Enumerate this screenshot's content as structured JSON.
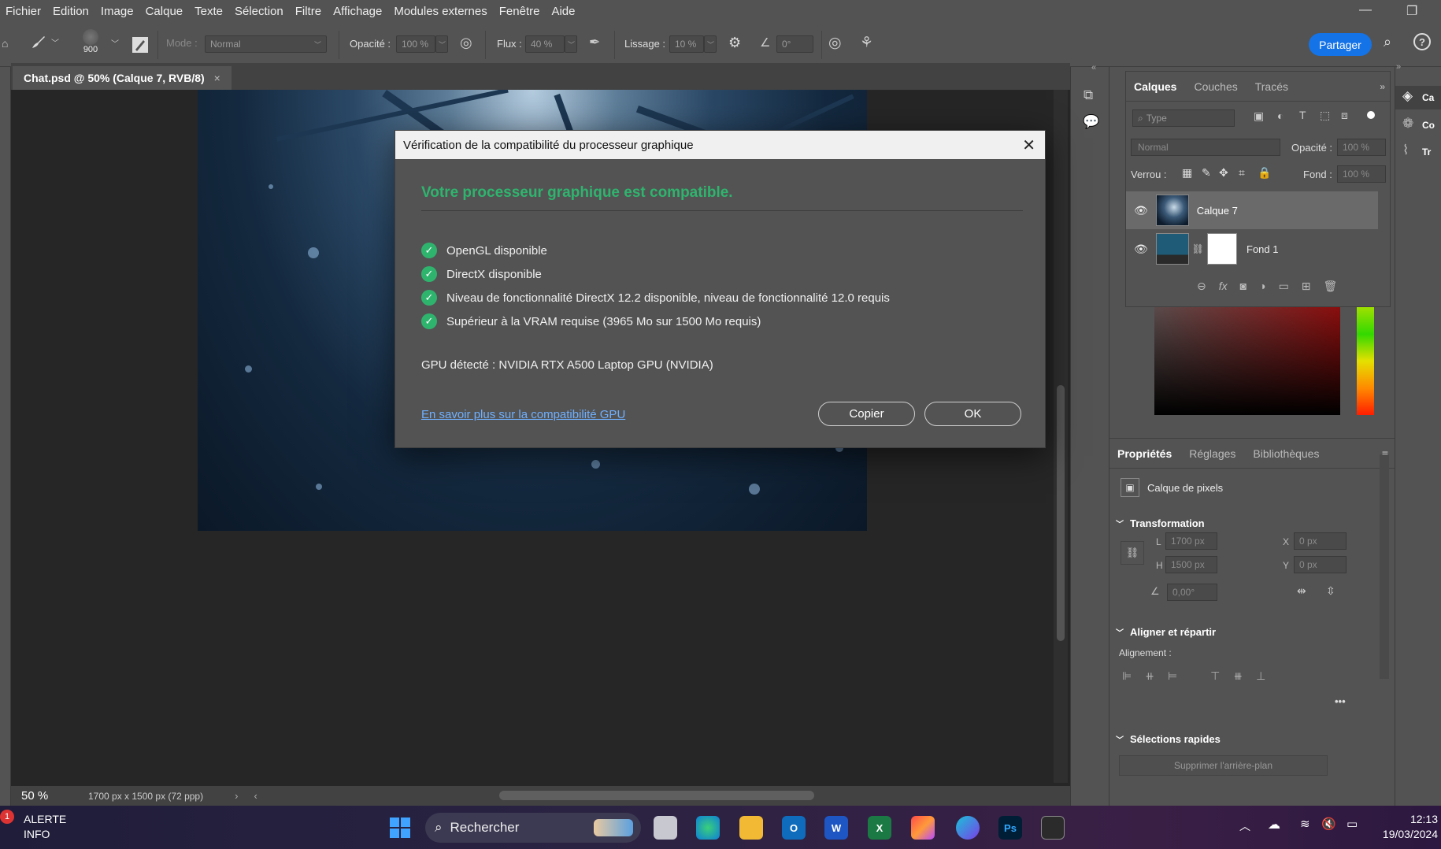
{
  "menu": [
    "Fichier",
    "Edition",
    "Image",
    "Calque",
    "Texte",
    "Sélection",
    "Filtre",
    "Affichage",
    "Modules externes",
    "Fenêtre",
    "Aide"
  ],
  "options": {
    "brush_size": "900",
    "mode_label": "Mode :",
    "mode_value": "Normal",
    "opacity_label": "Opacité :",
    "opacity_value": "100 %",
    "flow_label": "Flux :",
    "flow_value": "40 %",
    "smoothing_label": "Lissage :",
    "smoothing_value": "10 %",
    "angle_value": "0°",
    "share_label": "Partager"
  },
  "document": {
    "tab_title": "Chat.psd @ 50% (Calque 7, RVB/8)",
    "zoom": "50 %",
    "size_info": "1700 px x 1500 px (72 ppp)"
  },
  "layers_panel": {
    "tabs": [
      "Calques",
      "Couches",
      "Tracés"
    ],
    "search_placeholder": "Type",
    "blend_mode": "Normal",
    "opacity_label": "Opacité :",
    "opacity_value": "100 %",
    "lock_label": "Verrou :",
    "fill_label": "Fond :",
    "fill_value": "100 %",
    "layers": [
      {
        "name": "Calque 7",
        "selected": true
      },
      {
        "name": "Fond 1",
        "selected": false
      }
    ]
  },
  "properties": {
    "tabs": [
      "Propriétés",
      "Réglages",
      "Bibliothèques"
    ],
    "kind": "Calque de pixels",
    "transform_title": "Transformation",
    "L_label": "L",
    "L_value": "1700 px",
    "H_label": "H",
    "H_value": "1500 px",
    "X_label": "X",
    "X_value": "0 px",
    "Y_label": "Y",
    "Y_value": "0 px",
    "angle_value": "0,00°",
    "align_title": "Aligner et répartir",
    "alignment_label": "Alignement :",
    "quick_title": "Sélections rapides",
    "remove_bg_label": "Supprimer l'arrière-plan"
  },
  "far_right": [
    "Ca",
    "Co",
    "Tr"
  ],
  "dialog": {
    "title": "Vérification de la compatibilité du processeur graphique",
    "headline": "Votre processeur graphique est compatible.",
    "checks": [
      "OpenGL disponible",
      "DirectX disponible",
      "Niveau de fonctionnalité DirectX 12.2 disponible, niveau de fonctionnalité 12.0 requis",
      "Supérieur à la VRAM requise (3965 Mo sur 1500 Mo requis)"
    ],
    "gpu_line": "GPU détecté : NVIDIA RTX A500 Laptop GPU (NVIDIA)",
    "link": "En savoir plus sur la compatibilité GPU",
    "copy_label": "Copier",
    "ok_label": "OK"
  },
  "taskbar": {
    "alert_badge": "1",
    "alert_title": "ALERTE",
    "alert_sub": "INFO",
    "search_label": "Rechercher",
    "time": "12:13",
    "date": "19/03/2024",
    "apps": [
      "Ps"
    ]
  },
  "colors": {
    "accent": "#1473e6",
    "success": "#2fb46e",
    "link": "#6fb0ff"
  }
}
